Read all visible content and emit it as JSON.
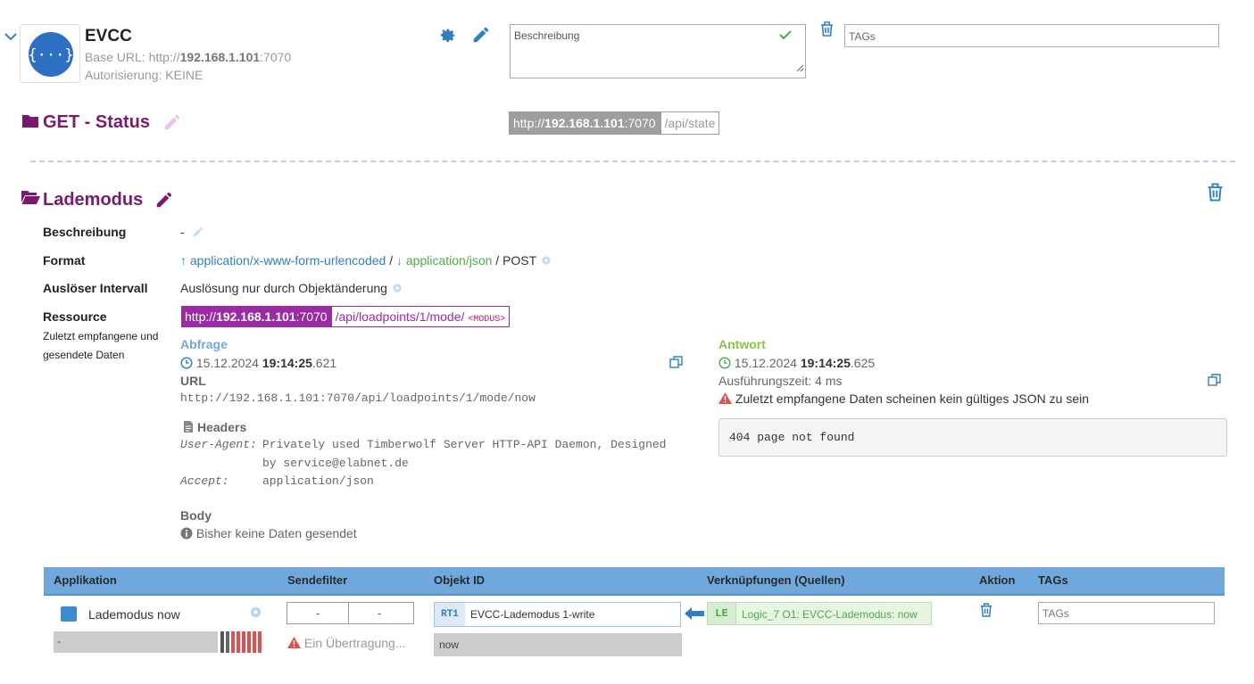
{
  "device": {
    "name": "EVCC",
    "base_url_label": "Base URL: ",
    "base_url_prefix": "http://",
    "base_url_host": "192.168.1.101",
    "base_url_port": ":7070",
    "auth": "Autorisierung: KEINE",
    "description_placeholder": "Beschreibung",
    "tags_placeholder": "TAGs"
  },
  "get_status": {
    "title": "GET - Status",
    "url_prefix": "http://",
    "url_host": "192.168.1.101",
    "url_port": ":7070",
    "path": "/api/state"
  },
  "lademodus": {
    "title": "Lademodus",
    "labels": {
      "beschreibung": "Beschreibung",
      "format": "Format",
      "ausloeser": "Auslöser Intervall",
      "ressource": "Ressource",
      "zuletzt": "Zuletzt empfangene und gesendete Daten"
    },
    "beschreibung_value": "-",
    "format": {
      "up": "application/x-www-form-urlencoded",
      "sep1": " / ",
      "down": "application/json",
      "sep2": " / ",
      "method": "POST"
    },
    "ausloeser_value": "Auslösung nur durch Objektänderung",
    "resource": {
      "prefix": "http://",
      "host": "192.168.1.101",
      "port": ":7070",
      "path": "/api/loadpoints/1/mode/",
      "param": "<MODUS>"
    },
    "abfrage": {
      "title": "Abfrage",
      "date": "15.12.2024",
      "time": "19:14:25",
      "ms": ".621",
      "url_label": "URL",
      "url": "http://192.168.1.101:7070/api/loadpoints/1/mode/now",
      "headers_label": "Headers",
      "header1_key": "User-Agent:",
      "header1_value_line1": "Privately used Timberwolf Server HTTP-API Daemon, Designed",
      "header1_value_line2": "by service@elabnet.de",
      "header2_key": "Accept:",
      "header2_value": "application/json",
      "body_label": "Body",
      "body_value": "Bisher keine Daten gesendet"
    },
    "antwort": {
      "title": "Antwort",
      "date": "15.12.2024",
      "time": "19:14:25",
      "ms": ".625",
      "exec_time": "Ausführungszeit: 4 ms",
      "warning": "Zuletzt empfangene Daten scheinen kein gültiges JSON zu sein",
      "response": "404 page not found"
    }
  },
  "table": {
    "headers": {
      "applikation": "Applikation",
      "sendefilter": "Sendefilter",
      "objekt_id": "Objekt ID",
      "verknuepfungen": "Verknüpfungen (Quellen)",
      "aktion": "Aktion",
      "tags": "TAGs"
    },
    "row": {
      "app_name": "Lademodus now",
      "app_value": "-",
      "filter_left": "-",
      "filter_right": "-",
      "filter_warning": "Ein Übertragung...",
      "object_badge": "RT1",
      "object_name": "EVCC-Lademodus 1-write",
      "object_value": "now",
      "link_badge": "LE",
      "link_name": "Logic_7 O1: EVCC-Lademodus: now",
      "tags_placeholder": "TAGs"
    }
  },
  "colors": {
    "purple": "#7a1a6e",
    "blue": "#2f7fc1",
    "green": "#4caa4c",
    "table_header": "#6fa8dc",
    "resource_bg": "#9c2aa5",
    "status_url_bg": "#9e9e9e",
    "bar_red": "#d9534f"
  }
}
